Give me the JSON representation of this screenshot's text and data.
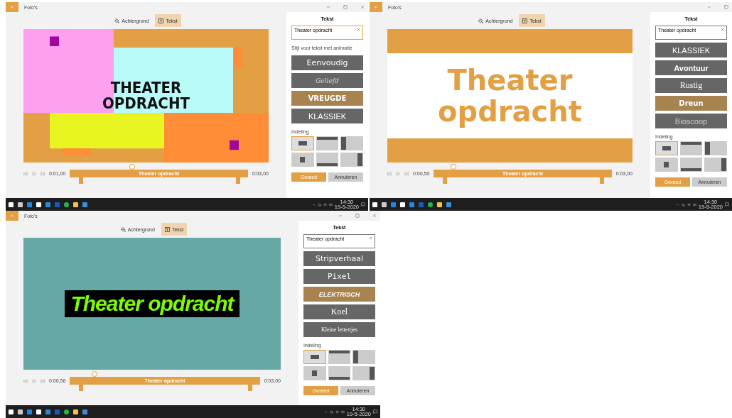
{
  "windows": [
    {
      "title": "Foto's",
      "tabs": [
        {
          "label": "Achtergrond",
          "kind": "background",
          "selected": false
        },
        {
          "label": "Tekst",
          "kind": "text",
          "selected": true
        }
      ],
      "preview": {
        "kind": "collage",
        "lines": [
          "THEATER",
          "OPDRACHT"
        ]
      },
      "timeline": {
        "start": "0:01,00",
        "end": "0:03,00",
        "clip": "Theater opdracht",
        "level": 0.35
      },
      "panel": {
        "heading": "Tekst",
        "input": {
          "value": "Theater opdracht",
          "focused": true
        },
        "style_label": "Stijl voor tekst met animatie",
        "styles": [
          {
            "label": "Eenvoudig",
            "kind": "sans",
            "selected": false
          },
          {
            "label": "Geliefd",
            "kind": "script",
            "selected": false
          },
          {
            "label": "VREUGDE",
            "kind": "heavy",
            "selected": true
          },
          {
            "label": "KLASSIEK",
            "kind": "light",
            "selected": false
          }
        ],
        "layout_label": "Indeling",
        "layouts": [
          {
            "kind": "center",
            "selected": true
          },
          {
            "kind": "top",
            "selected": false
          },
          {
            "kind": "left",
            "selected": false
          },
          {
            "kind": "middle",
            "selected": false
          },
          {
            "kind": "bottom",
            "selected": false
          },
          {
            "kind": "right",
            "selected": false
          }
        ],
        "buttons": [
          {
            "label": "Gereed",
            "kind": "primary"
          },
          {
            "label": "Annuleren",
            "kind": "secondary"
          }
        ]
      },
      "taskbar": {
        "time": "14:30",
        "date": "19-5-2020"
      }
    },
    {
      "title": "Foto's",
      "tabs": [
        {
          "label": "Achtergrond",
          "kind": "background",
          "selected": false
        },
        {
          "label": "Tekst",
          "kind": "text",
          "selected": true
        }
      ],
      "preview": {
        "kind": "banner",
        "lines": [
          "Theater",
          "opdracht"
        ]
      },
      "timeline": {
        "start": "0:00,50",
        "end": "0:03,00",
        "clip": "Theater opdracht",
        "level": 0.11
      },
      "panel": {
        "heading": "Tekst",
        "input": {
          "value": "Theater opdracht",
          "focused": false
        },
        "styles": [
          {
            "label": "KLASSIEK",
            "kind": "light",
            "selected": false
          },
          {
            "label": "Avontuur",
            "kind": "condensed",
            "selected": false
          },
          {
            "label": "Rustig",
            "kind": "serif",
            "selected": false
          },
          {
            "label": "Dreun",
            "kind": "heavy",
            "selected": true
          },
          {
            "label": "Bioscoop",
            "kind": "thin",
            "selected": false
          }
        ],
        "layout_label": "Indeling",
        "layouts": [
          {
            "kind": "center",
            "selected": true
          },
          {
            "kind": "top",
            "selected": false
          },
          {
            "kind": "left",
            "selected": false
          },
          {
            "kind": "middle",
            "selected": false
          },
          {
            "kind": "bottom",
            "selected": false
          },
          {
            "kind": "right",
            "selected": false
          }
        ],
        "buttons": [
          {
            "label": "Gereed",
            "kind": "primary"
          },
          {
            "label": "Annuleren",
            "kind": "secondary"
          }
        ]
      },
      "taskbar": {
        "time": "14:30",
        "date": "19-5-2020"
      }
    },
    {
      "title": "Foto's",
      "tabs": [
        {
          "label": "Achtergrond",
          "kind": "background",
          "selected": false
        },
        {
          "label": "Tekst",
          "kind": "text",
          "selected": true
        }
      ],
      "preview": {
        "kind": "neon",
        "lines": [
          "Theater opdracht"
        ]
      },
      "timeline": {
        "start": "0:00,56",
        "end": "0:03,00",
        "clip": "Theater opdracht",
        "level": 0.13
      },
      "panel": {
        "heading": "Tekst",
        "input": {
          "value": "Theater opdracht",
          "focused": false
        },
        "styles": [
          {
            "label": "Stripverhaal",
            "kind": "comic",
            "selected": false
          },
          {
            "label": "Pixel",
            "kind": "mono",
            "selected": false
          },
          {
            "label": "ELEKTRISCH",
            "kind": "italic",
            "selected": true
          },
          {
            "label": "Koel",
            "kind": "serif",
            "selected": false
          },
          {
            "label": "Kleine lettertjes",
            "kind": "small",
            "selected": false
          }
        ],
        "layout_label": "Indeling",
        "layouts": [
          {
            "kind": "center",
            "selected": true
          },
          {
            "kind": "top",
            "selected": false
          },
          {
            "kind": "left",
            "selected": false
          },
          {
            "kind": "middle",
            "selected": false
          },
          {
            "kind": "bottom",
            "selected": false
          },
          {
            "kind": "right",
            "selected": false
          }
        ],
        "buttons": [
          {
            "label": "Gereed",
            "kind": "primary"
          },
          {
            "label": "Annuleren",
            "kind": "secondary"
          }
        ]
      },
      "taskbar": {
        "time": "14:30",
        "date": "19-5-2020"
      }
    }
  ]
}
